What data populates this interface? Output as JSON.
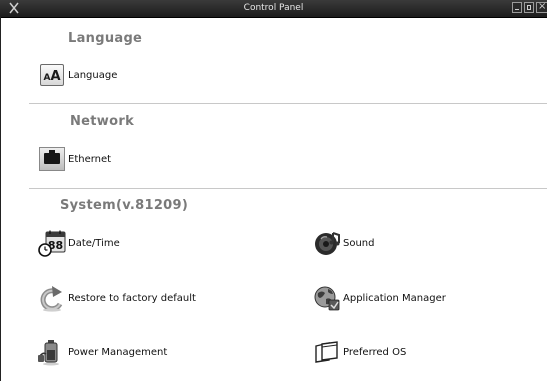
{
  "window": {
    "title": "Control Panel"
  },
  "sections": {
    "language": {
      "header": "Language",
      "items": [
        {
          "label": "Language",
          "icon": "language-icon"
        }
      ]
    },
    "network": {
      "header": "Network",
      "items": [
        {
          "label": "Ethernet",
          "icon": "ethernet-icon"
        }
      ]
    },
    "system": {
      "header": "System(v.81209)",
      "items": [
        {
          "label": "Date/Time",
          "icon": "calendar-clock-icon"
        },
        {
          "label": "Sound",
          "icon": "speaker-icon"
        },
        {
          "label": "Restore to factory default",
          "icon": "restore-arrow-icon"
        },
        {
          "label": "Application Manager",
          "icon": "globe-app-icon"
        },
        {
          "label": "Power Management",
          "icon": "battery-plug-icon"
        },
        {
          "label": "Preferred OS",
          "icon": "windows-stack-icon"
        }
      ]
    }
  },
  "icons": {
    "calendar_text": "88"
  }
}
